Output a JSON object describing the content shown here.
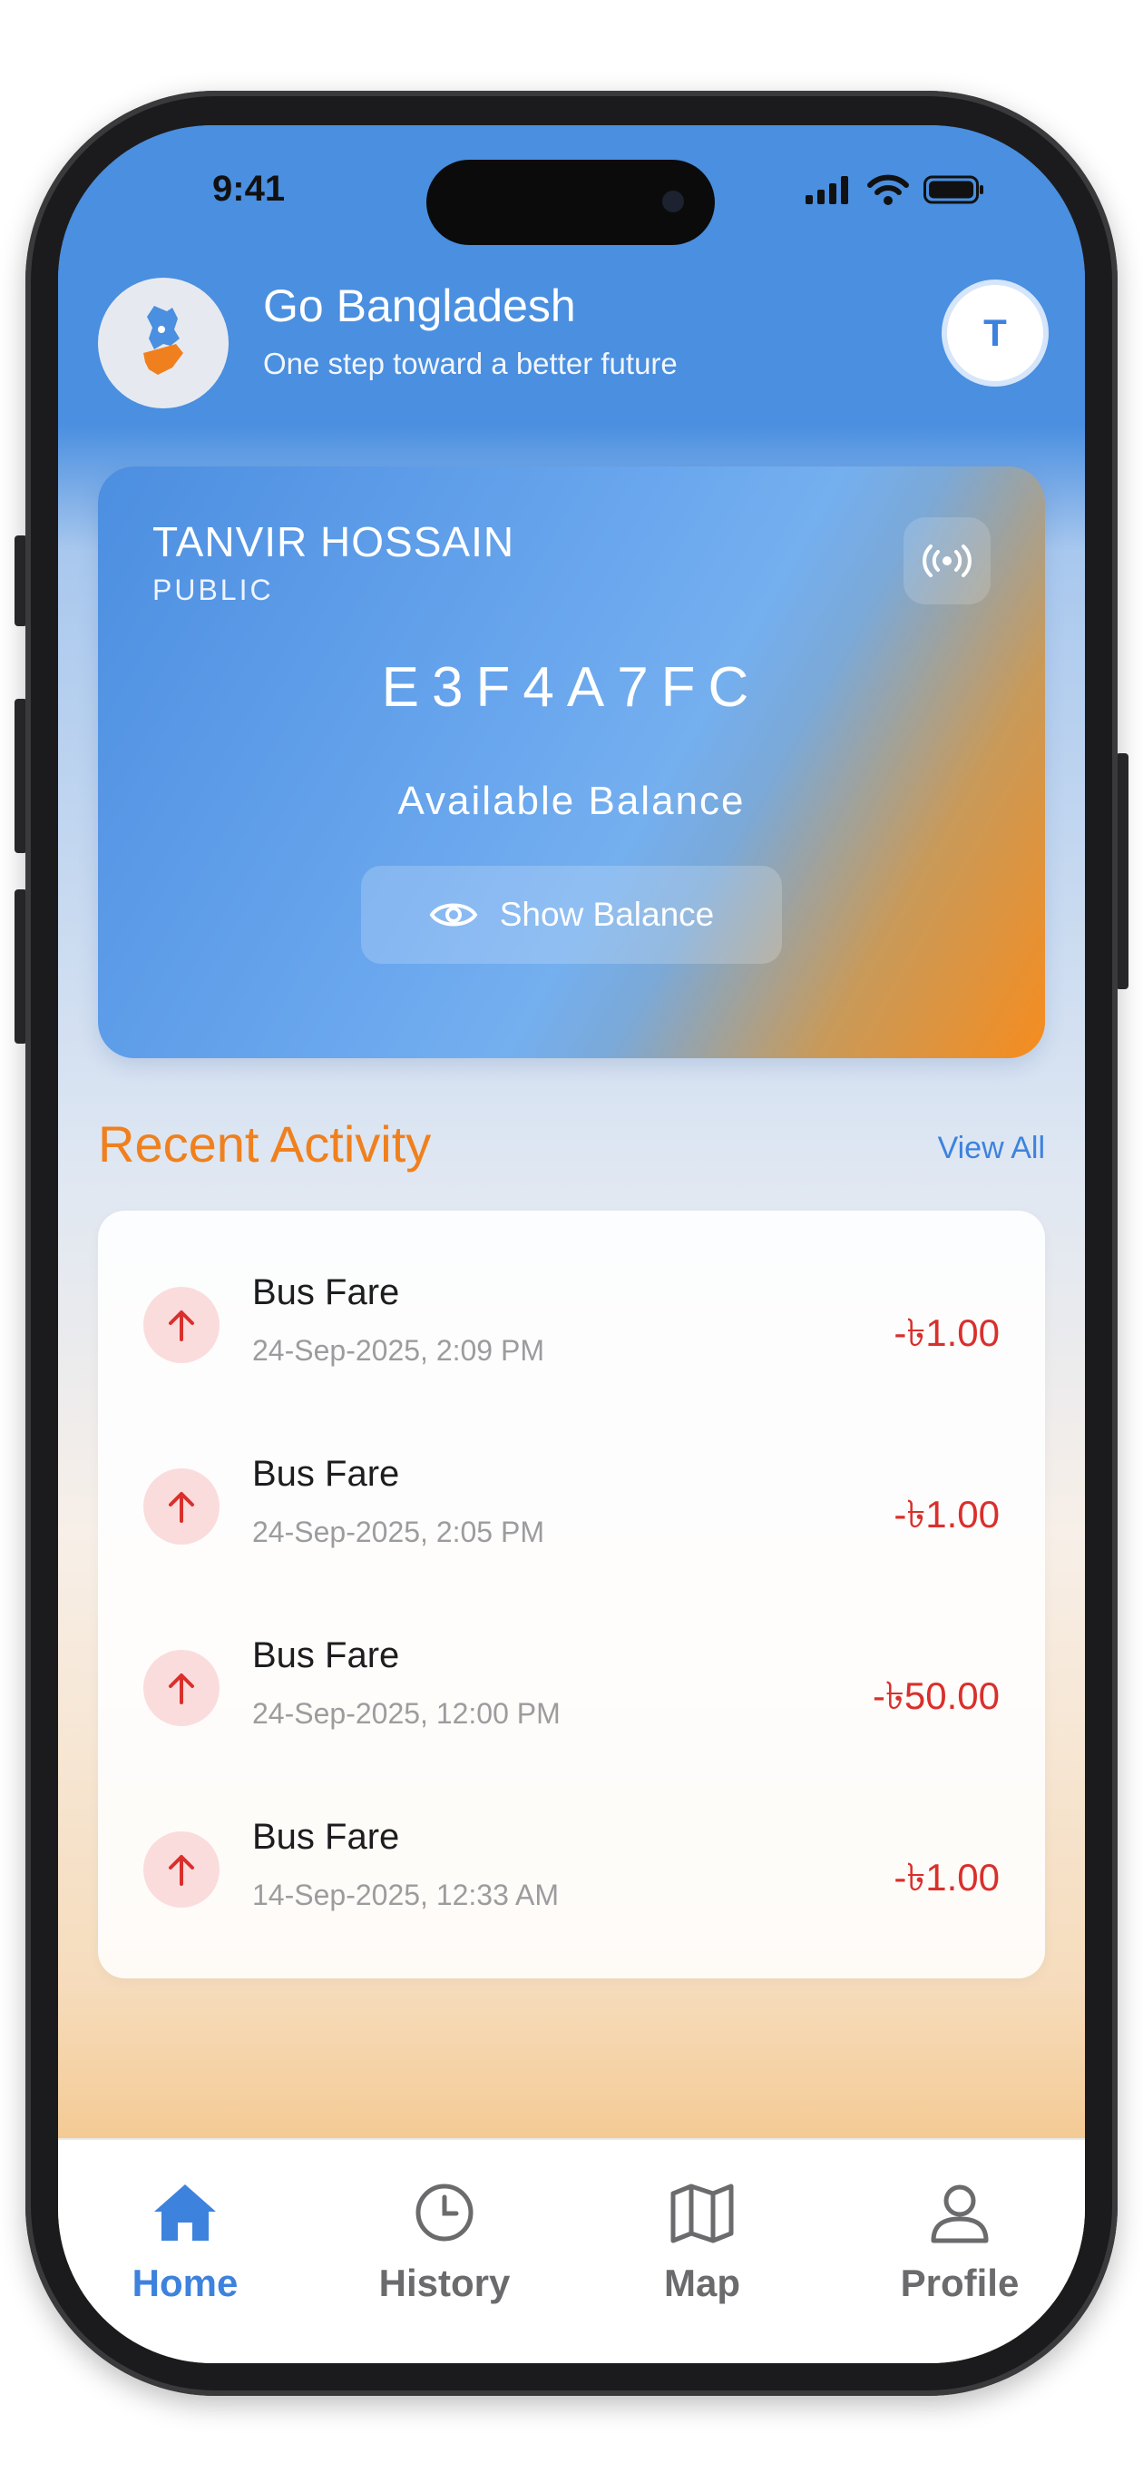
{
  "status_bar": {
    "time": "9:41"
  },
  "header": {
    "title": "Go Bangladesh",
    "subtitle": "One step toward a better future",
    "avatar_initial": "T"
  },
  "card": {
    "name": "TANVIR HOSSAIN",
    "type": "PUBLIC",
    "card_id": "E3F4A7FC",
    "balance_label": "Available Balance",
    "show_balance_label": "Show Balance"
  },
  "activity": {
    "title": "Recent Activity",
    "view_all": "View All",
    "items": [
      {
        "title": "Bus Fare",
        "date": "24-Sep-2025, 2:09 PM",
        "amount": "-৳1.00"
      },
      {
        "title": "Bus Fare",
        "date": "24-Sep-2025, 2:05 PM",
        "amount": "-৳1.00"
      },
      {
        "title": "Bus Fare",
        "date": "24-Sep-2025, 12:00 PM",
        "amount": "-৳50.00"
      },
      {
        "title": "Bus Fare",
        "date": "14-Sep-2025, 12:33 AM",
        "amount": "-৳1.00"
      }
    ]
  },
  "tabs": [
    {
      "label": "Home",
      "icon": "home-icon",
      "active": true
    },
    {
      "label": "History",
      "icon": "clock-icon",
      "active": false
    },
    {
      "label": "Map",
      "icon": "map-icon",
      "active": false
    },
    {
      "label": "Profile",
      "icon": "user-icon",
      "active": false
    }
  ],
  "colors": {
    "primary": "#4a8fe0",
    "accent": "#f0801d",
    "debit": "#d9302c"
  }
}
